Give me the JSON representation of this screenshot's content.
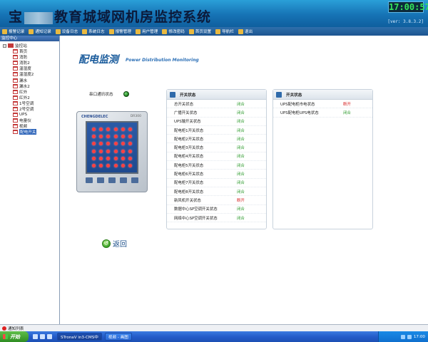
{
  "app": {
    "title_prefix": "宝",
    "title_suffix": "教育城域网机房监控系统",
    "clock": "17:00:57",
    "version": "[ver: 3.8.3.2]"
  },
  "menu": [
    {
      "label": "报警记录",
      "icon": "alarm-icon"
    },
    {
      "label": "通知记录",
      "icon": "notice-icon"
    },
    {
      "label": "设备日志",
      "icon": "log-icon"
    },
    {
      "label": "系统日志",
      "icon": "system-log-icon"
    },
    {
      "label": "报警管理",
      "icon": "alarm-manage-icon"
    },
    {
      "label": "用户管理",
      "icon": "user-icon"
    },
    {
      "label": "修改密码",
      "icon": "key-icon"
    },
    {
      "label": "首页设置",
      "icon": "settings-icon"
    },
    {
      "label": "导航栏",
      "icon": "nav-icon"
    },
    {
      "label": "退出",
      "icon": "exit-icon"
    }
  ],
  "left_panel": {
    "header": "监控中心",
    "root": "监控站",
    "items": [
      "首页",
      "消防",
      "消防2",
      "温湿度",
      "温湿度2",
      "漏水",
      "漏水2",
      "红外",
      "红外2",
      "1号空调",
      "2号空调",
      "UPS",
      "电量仪",
      "视频",
      "配电开关"
    ],
    "selected": "配电开关"
  },
  "page": {
    "title": "配电监测",
    "subtitle": "Power Distribution Monitoring",
    "serial_label": "串口通讯状态",
    "back_label": "返回"
  },
  "device": {
    "brand": "CHENGDELEC",
    "model": "DR300"
  },
  "switch_box_1": {
    "title": "开关状态",
    "rows": [
      {
        "name": "总开关状态",
        "value": "闭合",
        "status": "ok"
      },
      {
        "name": "广播开关状态",
        "value": "闭合",
        "status": "ok"
      },
      {
        "name": "UPS输开关状态",
        "value": "闭合",
        "status": "ok"
      },
      {
        "name": "配电柜1开关状态",
        "value": "闭合",
        "status": "ok"
      },
      {
        "name": "配电柜2开关状态",
        "value": "闭合",
        "status": "ok"
      },
      {
        "name": "配电柜3开关状态",
        "value": "闭合",
        "status": "ok"
      },
      {
        "name": "配电柜4开关状态",
        "value": "闭合",
        "status": "ok"
      },
      {
        "name": "配电柜5开关状态",
        "value": "闭合",
        "status": "ok"
      },
      {
        "name": "配电柜6开关状态",
        "value": "闭合",
        "status": "ok"
      },
      {
        "name": "配电柜7开关状态",
        "value": "闭合",
        "status": "ok"
      },
      {
        "name": "配电柜8开关状态",
        "value": "闭合",
        "status": "ok"
      },
      {
        "name": "新风机开关状态",
        "value": "断开",
        "status": "bad"
      },
      {
        "name": "数据中心SP空调开关状态",
        "value": "闭合",
        "status": "ok"
      },
      {
        "name": "网络中心SP空调开关状态",
        "value": "闭合",
        "status": "ok"
      }
    ]
  },
  "switch_box_2": {
    "title": "开关状态",
    "rows": [
      {
        "name": "UPS配电柜市电状态",
        "value": "断开",
        "status": "bad"
      },
      {
        "name": "UPS配电柜UPS电状态",
        "value": "闭合",
        "status": "ok"
      }
    ]
  },
  "notify_bar": {
    "label": "通知列表"
  },
  "taskbar": {
    "start": "开始",
    "tasks": [
      "STronaV in3-CMS中",
      "视频 - 画图"
    ],
    "time": "17:00"
  },
  "colors": {
    "ok": "#2b9a2b",
    "bad": "#d61e1e",
    "accent": "#1673b5"
  }
}
